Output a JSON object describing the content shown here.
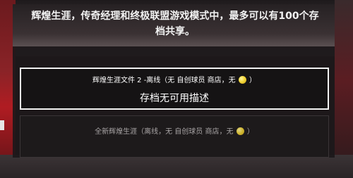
{
  "header": {
    "text": "辉煌生涯，传奇经理和终极联盟游戏模式中，最多可以有100个存档共享。"
  },
  "slots": [
    {
      "title_prefix": "辉煌生涯文件 2 -离线（无 自创球员 商店，无",
      "title_suffix": "）",
      "description": "存档无可用描述",
      "selected": true
    },
    {
      "title_prefix": "全新辉煌生涯（离线，无 自创球员 商店，无",
      "title_suffix": "）",
      "selected": false
    }
  ],
  "icons": {
    "coin": "coin-icon"
  },
  "colors": {
    "selected_border": "#f2f2f2",
    "coin": "#f3d63a"
  }
}
